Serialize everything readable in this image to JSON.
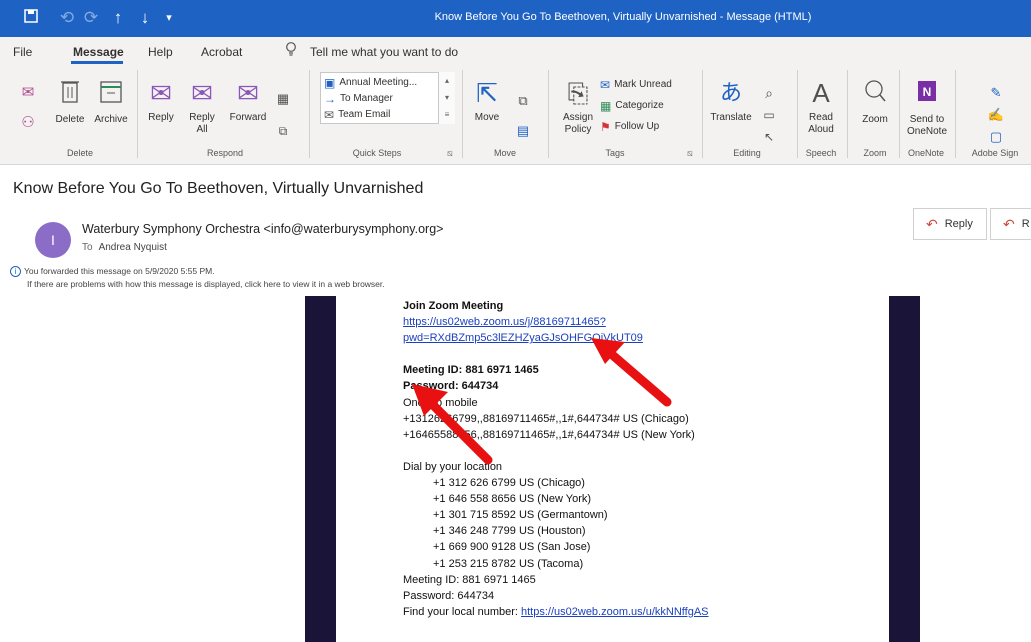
{
  "window": {
    "title": "Know Before You Go To Beethoven, Virtually Unvarnished  -  Message (HTML)",
    "title_bar_color": "#1e62c4"
  },
  "quick_access": {
    "save_icon": "save-icon",
    "undo_icon": "undo-icon",
    "redo_icon": "redo-icon",
    "up_icon": "arrow-up-icon",
    "down_icon": "arrow-down-icon",
    "customize_icon": "customize-icon"
  },
  "menu": {
    "tabs": [
      "File",
      "Message",
      "Help",
      "Acrobat"
    ],
    "tell_me": "Tell me what you want to do"
  },
  "ribbon": {
    "delete_group": {
      "label": "Delete",
      "delete": "Delete",
      "archive": "Archive"
    },
    "respond_group": {
      "label": "Respond",
      "reply": "Reply",
      "reply_all_1": "Reply",
      "reply_all_2": "All",
      "forward": "Forward"
    },
    "quick_steps_group": {
      "label": "Quick Steps",
      "items": [
        "Annual Meeting...",
        "To Manager",
        "Team Email"
      ]
    },
    "move_group": {
      "label": "Move",
      "move": "Move"
    },
    "tags_group": {
      "label": "Tags",
      "assign_1": "Assign",
      "assign_2": "Policy",
      "mark_unread": "Mark Unread",
      "categorize": "Categorize",
      "follow_up": "Follow Up"
    },
    "editing_group": {
      "label": "Editing",
      "translate": "Translate"
    },
    "speech_group": {
      "label": "Speech",
      "read_1": "Read",
      "read_2": "Aloud"
    },
    "zoom_group": {
      "label": "Zoom",
      "zoom": "Zoom"
    },
    "onenote_group": {
      "label": "OneNote",
      "send_1": "Send to",
      "send_2": "OneNote"
    },
    "adobe_group": {
      "label": "Adobe Sign"
    }
  },
  "message": {
    "subject": "Know Before You Go To Beethoven, Virtually Unvarnished",
    "avatar_initial": "I",
    "avatar_color": "#8b6cc7",
    "sender": "Waterbury Symphony Orchestra <info@waterburysymphony.org>",
    "to_label": "To",
    "to_name": "Andrea Nyquist",
    "info_forwarded": "You forwarded this message on 5/9/2020 5:55 PM.",
    "info_problems": "If there are problems with how this message is displayed, click here to view it in a web browser.",
    "reply_button": "Reply",
    "reply_all_button": "R"
  },
  "body": {
    "band_color": "#1a1538",
    "join_title": "Join Zoom Meeting",
    "link_1": "https://us02web.zoom.us/j/88169711465?",
    "link_2": "pwd=RXdBZmp5c3lEZHZyaGJsOHFGQjVkUT09",
    "meeting_id": "Meeting ID: 881 6971 1465",
    "password": "Password: 644734",
    "one_tap": "One tap mobile",
    "tap_1": "+13126266799,,88169711465#,,1#,644734# US (Chicago)",
    "tap_2": "+16465588656,,88169711465#,,1#,644734# US (New York)",
    "dial_title": "Dial by your location",
    "numbers": [
      "+1 312 626 6799 US (Chicago)",
      "+1 646 558 8656 US (New York)",
      "+1 301 715 8592 US (Germantown)",
      "+1 346 248 7799 US (Houston)",
      "+1 669 900 9128 US (San Jose)",
      "+1 253 215 8782 US (Tacoma)"
    ],
    "meeting_id_2": "Meeting ID: 881 6971 1465",
    "password_2": "Password: 644734",
    "find_local": "Find your local number: ",
    "find_link": "https://us02web.zoom.us/u/kkNNffgAS"
  },
  "annotations": {
    "arrow_color": "#e81010"
  }
}
